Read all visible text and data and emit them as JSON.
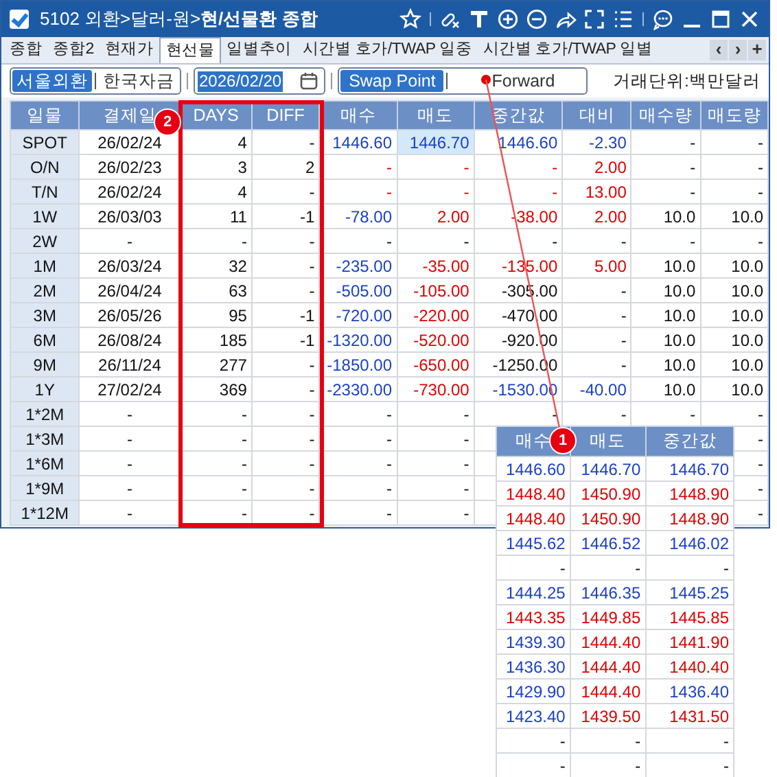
{
  "window": {
    "title": "5102 외환>달러-원>**현/선물환 종합**",
    "checked": true
  },
  "tabs": [
    {
      "label": "종합",
      "selected": false
    },
    {
      "label": "종합2",
      "selected": false
    },
    {
      "label": "현재가",
      "selected": false
    },
    {
      "label": "현선물",
      "selected": true
    },
    {
      "label": "일별추이",
      "selected": false
    },
    {
      "label": "시간별 호가/TWAP 일중",
      "selected": false
    },
    {
      "label": "시간별 호가/TWAP 일별",
      "selected": false
    }
  ],
  "tab_nav": [
    "‹",
    "›",
    "+"
  ],
  "market_toggle": [
    {
      "label": "서울외환",
      "selected": true
    },
    {
      "label": "한국자금",
      "selected": false
    }
  ],
  "date_field": {
    "value": "2026/02/20"
  },
  "mode_toggle": [
    {
      "label": "Swap Point",
      "selected": true
    },
    {
      "label": "Forward",
      "selected": false
    }
  ],
  "unit_label": "거래단위:백만달러",
  "table": {
    "columns": [
      "일물",
      "결제일",
      "DAYS",
      "DIFF",
      "매수",
      "매도",
      "중간값",
      "대비",
      "매수량",
      "매도량"
    ],
    "rows": [
      {
        "tenor": "SPOT",
        "date": "26/02/24",
        "days": "4",
        "diff": "-",
        "bid": {
          "text": "1446.60",
          "color": "#1a3fc8"
        },
        "ask": {
          "text": "1446.70",
          "color": "#1a3fc8",
          "highlighted": true
        },
        "mid": {
          "text": "1446.60",
          "color": "#1a3fc8"
        },
        "change": {
          "text": "-2.30",
          "color": "#1a3fc8"
        },
        "bid_qty": "-",
        "ask_qty": "-"
      },
      {
        "tenor": "O/N",
        "date": "26/02/23",
        "days": "3",
        "diff": "2",
        "bid": {
          "text": "-",
          "color": "#e00000"
        },
        "ask": {
          "text": "-",
          "color": "#e00000"
        },
        "mid": {
          "text": "-",
          "color": "#e00000"
        },
        "change": {
          "text": "2.00",
          "color": "#e00000"
        },
        "bid_qty": "-",
        "ask_qty": "-"
      },
      {
        "tenor": "T/N",
        "date": "26/02/24",
        "days": "4",
        "diff": "-",
        "bid": {
          "text": "-",
          "color": "#e00000"
        },
        "ask": {
          "text": "-",
          "color": "#e00000"
        },
        "mid": {
          "text": "-",
          "color": "#e00000"
        },
        "change": {
          "text": "13.00",
          "color": "#e00000"
        },
        "bid_qty": "-",
        "ask_qty": "-"
      },
      {
        "tenor": "1W",
        "date": "26/03/03",
        "days": "11",
        "diff": "-1",
        "bid": {
          "text": "-78.00",
          "color": "#1a3fc8"
        },
        "ask": {
          "text": "2.00",
          "color": "#e00000"
        },
        "mid": {
          "text": "-38.00",
          "color": "#e00000"
        },
        "change": {
          "text": "2.00",
          "color": "#e00000"
        },
        "bid_qty": "10.0",
        "ask_qty": "10.0"
      },
      {
        "tenor": "2W",
        "date": "-",
        "days": "-",
        "diff": "-",
        "bid": "-",
        "ask": "-",
        "mid": "-",
        "change": "-",
        "bid_qty": "-",
        "ask_qty": "-"
      },
      {
        "tenor": "1M",
        "date": "26/03/24",
        "days": "32",
        "diff": "-",
        "bid": {
          "text": "-235.00",
          "color": "#1a3fc8"
        },
        "ask": {
          "text": "-35.00",
          "color": "#e00000"
        },
        "mid": {
          "text": "-135.00",
          "color": "#e00000"
        },
        "change": {
          "text": "5.00",
          "color": "#e00000"
        },
        "bid_qty": "10.0",
        "ask_qty": "10.0"
      },
      {
        "tenor": "2M",
        "date": "26/04/24",
        "days": "63",
        "diff": "-",
        "bid": {
          "text": "-505.00",
          "color": "#1a3fc8"
        },
        "ask": {
          "text": "-105.00",
          "color": "#e00000"
        },
        "mid": "-305.00",
        "change": "-",
        "bid_qty": "10.0",
        "ask_qty": "10.0"
      },
      {
        "tenor": "3M",
        "date": "26/05/26",
        "days": "95",
        "diff": "-1",
        "bid": {
          "text": "-720.00",
          "color": "#1a3fc8"
        },
        "ask": {
          "text": "-220.00",
          "color": "#e00000"
        },
        "mid": "-470.00",
        "change": "-",
        "bid_qty": "10.0",
        "ask_qty": "10.0"
      },
      {
        "tenor": "6M",
        "date": "26/08/24",
        "days": "185",
        "diff": "-1",
        "bid": {
          "text": "-1320.00",
          "color": "#1a3fc8"
        },
        "ask": {
          "text": "-520.00",
          "color": "#e00000"
        },
        "mid": "-920.00",
        "change": "-",
        "bid_qty": "10.0",
        "ask_qty": "10.0"
      },
      {
        "tenor": "9M",
        "date": "26/11/24",
        "days": "277",
        "diff": "-",
        "bid": {
          "text": "-1850.00",
          "color": "#1a3fc8"
        },
        "ask": {
          "text": "-650.00",
          "color": "#e00000"
        },
        "mid": "-1250.00",
        "change": "-",
        "bid_qty": "10.0",
        "ask_qty": "10.0"
      },
      {
        "tenor": "1Y",
        "date": "27/02/24",
        "days": "369",
        "diff": "-",
        "bid": {
          "text": "-2330.00",
          "color": "#1a3fc8"
        },
        "ask": {
          "text": "-730.00",
          "color": "#e00000"
        },
        "mid": {
          "text": "-1530.00",
          "color": "#1a3fc8"
        },
        "change": {
          "text": "-40.00",
          "color": "#1a3fc8"
        },
        "bid_qty": "10.0",
        "ask_qty": "10.0"
      },
      {
        "tenor": "1*2M",
        "date": "-",
        "days": "-",
        "diff": "-",
        "bid": "-",
        "ask": "-",
        "mid": "-",
        "change": "-",
        "bid_qty": "-",
        "ask_qty": "-"
      },
      {
        "tenor": "1*3M",
        "date": "-",
        "days": "-",
        "diff": "-",
        "bid": "-",
        "ask": "-",
        "ask_qty": "-"
      },
      {
        "tenor": "1*6M",
        "date": "-",
        "days": "-",
        "diff": "-",
        "bid": "-",
        "ask": "-",
        "ask_qty": "-"
      },
      {
        "tenor": "1*9M",
        "date": "-",
        "days": "-",
        "diff": "-",
        "bid": "-",
        "ask": "-",
        "ask_qty": "-"
      },
      {
        "tenor": "1*12M",
        "date": "-",
        "days": "-",
        "diff": "-",
        "bid": "-",
        "ask": "-",
        "ask_qty": "-"
      }
    ]
  },
  "forward_panel": {
    "columns": [
      "매수",
      "매도",
      "중간값"
    ],
    "rows": [
      [
        {
          "text": "1446.60",
          "color": "#1a3fc8"
        },
        {
          "text": "1446.70",
          "color": "#1a3fc8"
        },
        {
          "text": "1446.70",
          "color": "#1a3fc8"
        }
      ],
      [
        {
          "text": "1448.40",
          "color": "#e00000"
        },
        {
          "text": "1450.90",
          "color": "#e00000"
        },
        {
          "text": "1448.90",
          "color": "#e00000"
        }
      ],
      [
        {
          "text": "1448.40",
          "color": "#e00000"
        },
        {
          "text": "1450.90",
          "color": "#e00000"
        },
        {
          "text": "1448.90",
          "color": "#e00000"
        }
      ],
      [
        {
          "text": "1445.62",
          "color": "#1a3fc8"
        },
        {
          "text": "1446.52",
          "color": "#1a3fc8"
        },
        {
          "text": "1446.02",
          "color": "#1a3fc8"
        }
      ],
      [
        "-",
        "-",
        "-"
      ],
      [
        {
          "text": "1444.25",
          "color": "#1a3fc8"
        },
        {
          "text": "1446.35",
          "color": "#1a3fc8"
        },
        {
          "text": "1445.25",
          "color": "#1a3fc8"
        }
      ],
      [
        {
          "text": "1443.35",
          "color": "#e00000"
        },
        {
          "text": "1449.85",
          "color": "#e00000"
        },
        {
          "text": "1445.85",
          "color": "#e00000"
        }
      ],
      [
        {
          "text": "1439.30",
          "color": "#1a3fc8"
        },
        {
          "text": "1444.40",
          "color": "#e00000"
        },
        {
          "text": "1441.90",
          "color": "#e00000"
        }
      ],
      [
        {
          "text": "1436.30",
          "color": "#1a3fc8"
        },
        {
          "text": "1444.40",
          "color": "#e00000"
        },
        {
          "text": "1440.40",
          "color": "#e00000"
        }
      ],
      [
        {
          "text": "1429.90",
          "color": "#1a3fc8"
        },
        {
          "text": "1444.40",
          "color": "#e00000"
        },
        {
          "text": "1436.40",
          "color": "#1a3fc8"
        }
      ],
      [
        {
          "text": "1423.40",
          "color": "#1a3fc8"
        },
        {
          "text": "1439.50",
          "color": "#e00000"
        },
        {
          "text": "1431.50",
          "color": "#e00000"
        }
      ],
      [
        "-",
        "-",
        "-"
      ],
      [
        "-",
        "-",
        "-"
      ]
    ]
  },
  "callouts": [
    {
      "number": "1"
    },
    {
      "number": "2"
    }
  ]
}
